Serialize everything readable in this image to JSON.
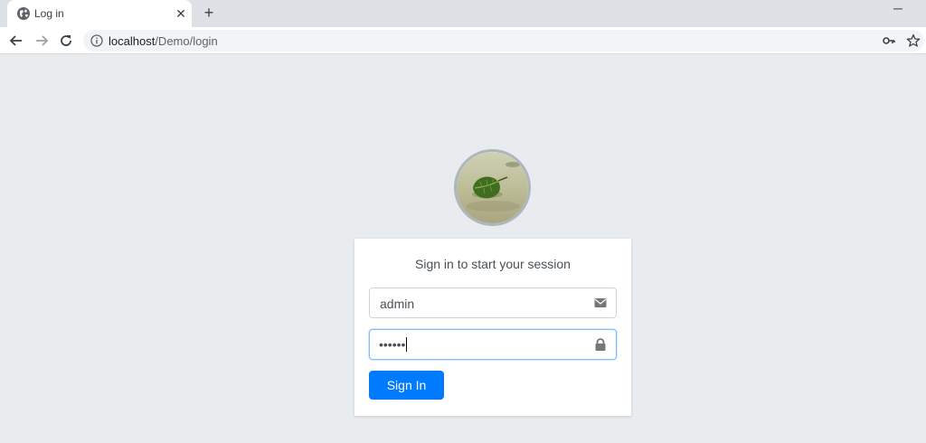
{
  "browser": {
    "tab": {
      "title": "Log in",
      "icon": "globe-icon"
    },
    "url": {
      "host": "localhost",
      "path": "/Demo/login"
    },
    "minimize_glyph": "─",
    "new_tab_glyph": "+",
    "close_glyph": "✕"
  },
  "login": {
    "heading": "Sign in to start your session",
    "username": {
      "value": "admin",
      "icon": "envelope-icon"
    },
    "password": {
      "masked": "••••••",
      "icon": "lock-icon"
    },
    "submit_label": "Sign In"
  },
  "colors": {
    "primary": "#007bff",
    "page_background": "#e9ecef",
    "card": "#ffffff"
  }
}
